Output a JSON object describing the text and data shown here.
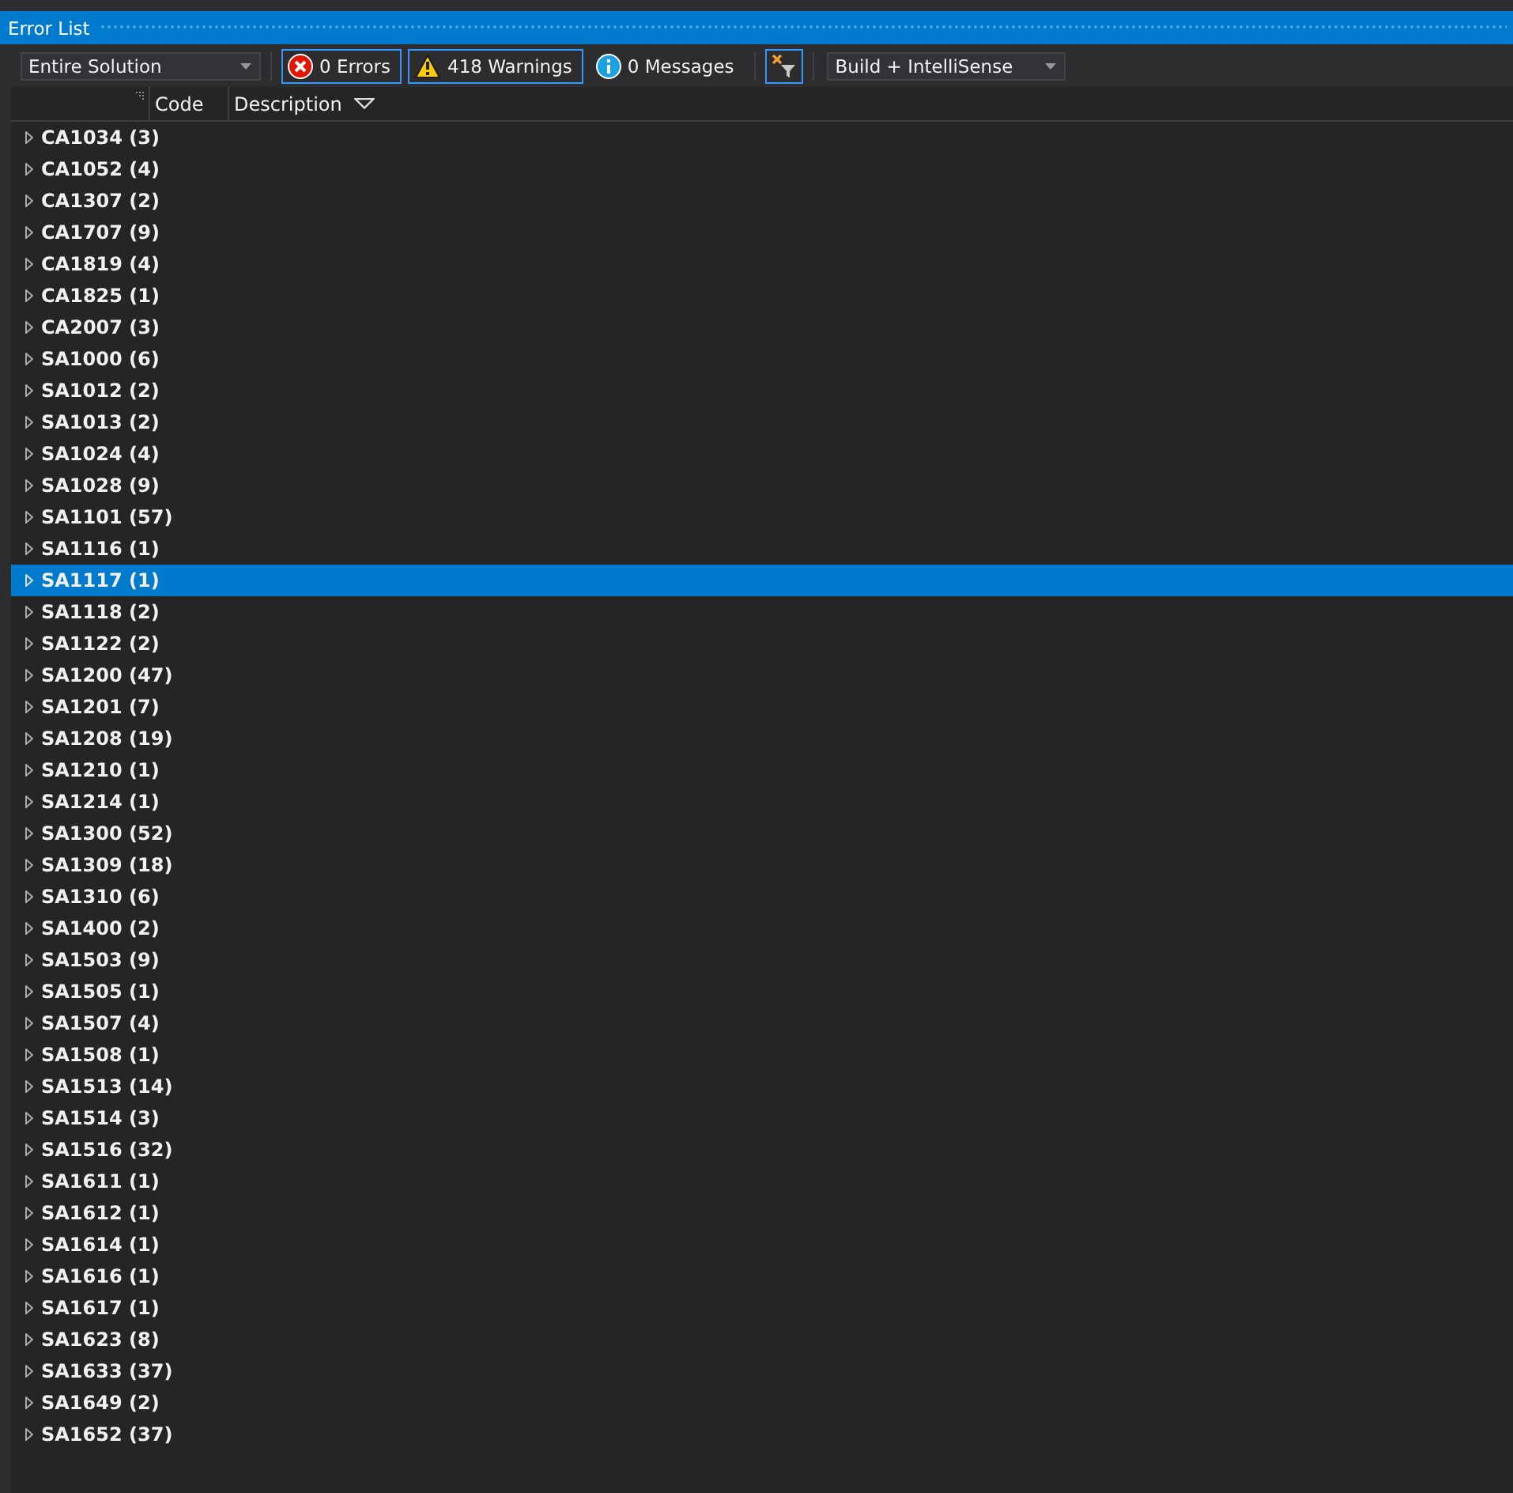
{
  "window": {
    "title": "Error List"
  },
  "toolbar": {
    "scope": "Entire Solution",
    "filters": [
      {
        "kind": "error",
        "label": "0 Errors",
        "selected": true
      },
      {
        "kind": "warning",
        "label": "418 Warnings",
        "selected": true
      },
      {
        "kind": "info",
        "label": "0 Messages",
        "selected": false
      }
    ],
    "clear_filter": {
      "selected": true
    },
    "source": "Build + IntelliSense"
  },
  "table": {
    "columns": [
      {
        "label": "Code",
        "sorted": false
      },
      {
        "label": "Description",
        "sorted": true
      }
    ],
    "rows": [
      {
        "label": "CA1034 (3)",
        "selected": false
      },
      {
        "label": "CA1052 (4)",
        "selected": false
      },
      {
        "label": "CA1307 (2)",
        "selected": false
      },
      {
        "label": "CA1707 (9)",
        "selected": false
      },
      {
        "label": "CA1819 (4)",
        "selected": false
      },
      {
        "label": "CA1825 (1)",
        "selected": false
      },
      {
        "label": "CA2007 (3)",
        "selected": false
      },
      {
        "label": "SA1000 (6)",
        "selected": false
      },
      {
        "label": "SA1012 (2)",
        "selected": false
      },
      {
        "label": "SA1013 (2)",
        "selected": false
      },
      {
        "label": "SA1024 (4)",
        "selected": false
      },
      {
        "label": "SA1028 (9)",
        "selected": false
      },
      {
        "label": "SA1101 (57)",
        "selected": false
      },
      {
        "label": "SA1116 (1)",
        "selected": false
      },
      {
        "label": "SA1117 (1)",
        "selected": true
      },
      {
        "label": "SA1118 (2)",
        "selected": false
      },
      {
        "label": "SA1122 (2)",
        "selected": false
      },
      {
        "label": "SA1200 (47)",
        "selected": false
      },
      {
        "label": "SA1201 (7)",
        "selected": false
      },
      {
        "label": "SA1208 (19)",
        "selected": false
      },
      {
        "label": "SA1210 (1)",
        "selected": false
      },
      {
        "label": "SA1214 (1)",
        "selected": false
      },
      {
        "label": "SA1300 (52)",
        "selected": false
      },
      {
        "label": "SA1309 (18)",
        "selected": false
      },
      {
        "label": "SA1310 (6)",
        "selected": false
      },
      {
        "label": "SA1400 (2)",
        "selected": false
      },
      {
        "label": "SA1503 (9)",
        "selected": false
      },
      {
        "label": "SA1505 (1)",
        "selected": false
      },
      {
        "label": "SA1507 (4)",
        "selected": false
      },
      {
        "label": "SA1508 (1)",
        "selected": false
      },
      {
        "label": "SA1513 (14)",
        "selected": false
      },
      {
        "label": "SA1514 (3)",
        "selected": false
      },
      {
        "label": "SA1516 (32)",
        "selected": false
      },
      {
        "label": "SA1611 (1)",
        "selected": false
      },
      {
        "label": "SA1612 (1)",
        "selected": false
      },
      {
        "label": "SA1614 (1)",
        "selected": false
      },
      {
        "label": "SA1616 (1)",
        "selected": false
      },
      {
        "label": "SA1617 (1)",
        "selected": false
      },
      {
        "label": "SA1623 (8)",
        "selected": false
      },
      {
        "label": "SA1633 (37)",
        "selected": false
      },
      {
        "label": "SA1649 (2)",
        "selected": false
      },
      {
        "label": "SA1652 (37)",
        "selected": false
      }
    ]
  }
}
